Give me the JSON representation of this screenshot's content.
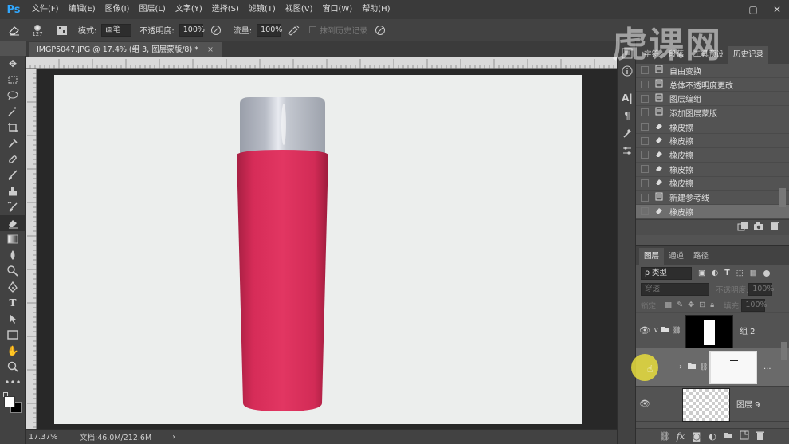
{
  "app": {
    "logo": "Ps",
    "menu": [
      "文件(F)",
      "编辑(E)",
      "图像(I)",
      "图层(L)",
      "文字(Y)",
      "选择(S)",
      "滤镜(T)",
      "视图(V)",
      "窗口(W)",
      "帮助(H)"
    ],
    "window_controls": [
      "—",
      "▢",
      "✕"
    ]
  },
  "options": {
    "brush_size": "127",
    "mode_label": "模式:",
    "mode_value": "画笔",
    "opacity_label": "不透明度:",
    "opacity_value": "100%",
    "flow_label": "流量:",
    "flow_value": "100%",
    "history_label": "抹到历史记录"
  },
  "document": {
    "tab_title": "IMGP5047.JPG @ 17.4% (组 3, 图层蒙版/8) *",
    "close": "×"
  },
  "status": {
    "zoom": "17.37%",
    "doc_info": "文档:46.0M/212.6M",
    "arrow": "›"
  },
  "watermark": "虎课网",
  "history_panel": {
    "tabs": [
      "字符",
      "段落",
      "工具预设",
      "历史记录"
    ],
    "active_tab": 3,
    "items": [
      {
        "label": "自由变换",
        "icon": "doc-icon"
      },
      {
        "label": "总体不透明度更改",
        "icon": "doc-icon"
      },
      {
        "label": "图层编组",
        "icon": "doc-icon"
      },
      {
        "label": "添加图层蒙版",
        "icon": "doc-icon"
      },
      {
        "label": "橡皮擦",
        "icon": "eraser-icon"
      },
      {
        "label": "橡皮擦",
        "icon": "eraser-icon"
      },
      {
        "label": "橡皮擦",
        "icon": "eraser-icon"
      },
      {
        "label": "橡皮擦",
        "icon": "eraser-icon"
      },
      {
        "label": "橡皮擦",
        "icon": "eraser-icon"
      },
      {
        "label": "新建参考线",
        "icon": "doc-icon"
      },
      {
        "label": "橡皮擦",
        "icon": "eraser-icon"
      }
    ],
    "selected_index": 10
  },
  "layers_panel": {
    "tabs": [
      "图层",
      "通道",
      "路径"
    ],
    "filter_label": "ρ 类型",
    "blend_mode": "穿透",
    "opacity_label": "不透明度:",
    "opacity_value": "100%",
    "lock_label": "锁定:",
    "fill_label": "填充:",
    "fill_value": "100%",
    "layers": [
      {
        "name": "组 2",
        "type": "group"
      },
      {
        "name": "...",
        "type": "group-mask"
      },
      {
        "name": "图层 9",
        "type": "pixel"
      }
    ]
  },
  "colors": {
    "bottle_pink": "#e03560",
    "cap_gray": "#b4b8c2",
    "canvas_bg": "#eceeed"
  }
}
